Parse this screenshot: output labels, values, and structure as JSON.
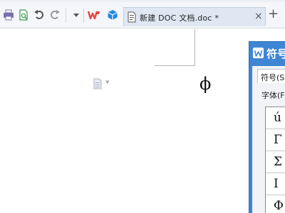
{
  "toolbar": {
    "items": [
      {
        "name": "print-icon"
      },
      {
        "name": "print-preview-icon"
      },
      {
        "name": "undo-icon"
      },
      {
        "name": "redo-icon"
      },
      {
        "name": "dropdown-icon"
      },
      {
        "name": "wps-logo-icon"
      },
      {
        "name": "cube-icon"
      }
    ],
    "doc_tab": {
      "title": "新建 DOC 文档.doc *",
      "close_glyph": "×"
    },
    "new_tab_glyph": "+"
  },
  "document": {
    "inserted_char": "ϕ"
  },
  "symbol_dialog": {
    "title": "符号",
    "tab_label": "符号(S)",
    "font_label": "字体(F):",
    "symbols": [
      "ú",
      "Γ",
      "Σ",
      "Ι",
      "Φ"
    ]
  },
  "colors": {
    "accent": "#3e86d4",
    "tab_bg": "#dfe7f3",
    "wps_red": "#e8453c",
    "cube_blue": "#1e88e5"
  }
}
